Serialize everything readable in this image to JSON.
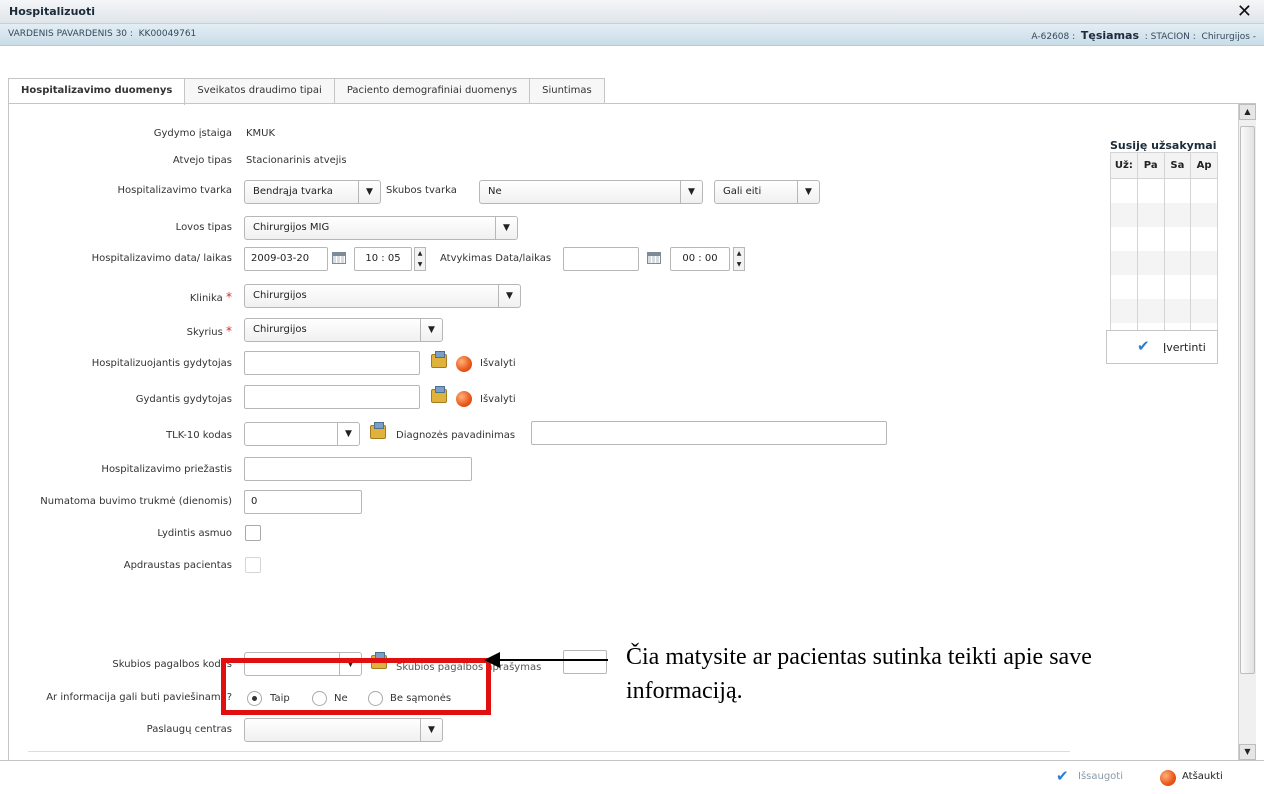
{
  "window": {
    "title": "Hospitalizuoti",
    "close_glyph": "✕"
  },
  "infobar": {
    "patient": "VARDENIS PAVARDENIS 30 :",
    "patient_code": "KK00049761",
    "case_code": "A-62608 :",
    "status": "Tęsiamas",
    "dept_type": ":  STACION :",
    "dept": "Chirurgijos -"
  },
  "tabs": [
    {
      "label": "Hospitalizavimo duomenys",
      "active": true
    },
    {
      "label": "Sveikatos draudimo tipai",
      "active": false
    },
    {
      "label": "Paciento demografiniai duomenys",
      "active": false
    },
    {
      "label": "Siuntimas",
      "active": false
    }
  ],
  "form": {
    "gydymo_istaiga": {
      "label": "Gydymo įstaiga",
      "value": "KMUK"
    },
    "atvejo_tipas": {
      "label": "Atvejo tipas",
      "value": "Stacionarinis atvejis"
    },
    "hosp_tvarka": {
      "label": "Hospitalizavimo tvarka",
      "value": "Bendrąja tvarka"
    },
    "skubos_tvarka": {
      "label": "Skubos tvarka",
      "value": "Ne"
    },
    "gali_eiti": {
      "value": "Gali eiti"
    },
    "lovos_tipas": {
      "label": "Lovos tipas",
      "value": "Chirurgijos  MIG"
    },
    "hosp_data": {
      "label": "Hospitalizavimo data/ laikas",
      "date": "2009-03-20",
      "time": "10 : 05"
    },
    "atvykimas": {
      "label": "Atvykimas Data/laikas",
      "date": "",
      "time": "00 : 00"
    },
    "klinika": {
      "label": "Klinika",
      "value": "Chirurgijos"
    },
    "skyrius": {
      "label": "Skyrius",
      "value": "Chirurgijos"
    },
    "hosp_gydytojas": {
      "label": "Hospitalizuojantis gydytojas",
      "value": "",
      "clear": "Išvalyti"
    },
    "gydantis_gydytojas": {
      "label": "Gydantis gydytojas",
      "value": "",
      "clear": "Išvalyti"
    },
    "tlk": {
      "label": "TLK-10 kodas",
      "value": "",
      "diag_label": "Diagnozės pavadinimas",
      "diag_value": ""
    },
    "priezastis": {
      "label": "Hospitalizavimo priežastis",
      "value": ""
    },
    "trukme": {
      "label": "Numatoma buvimo trukmė (dienomis)",
      "value": "0"
    },
    "lydintis": {
      "label": "Lydintis asmuo",
      "checked": false
    },
    "apdraustas": {
      "label": "Apdraustas pacientas",
      "checked": false
    },
    "skubios_kodas": {
      "label": "Skubios pagalbos kodas",
      "value": "",
      "desc_label": "Skubios pagalbos aprašymas"
    },
    "informacija": {
      "label": "Ar informacija gali buti paviešinama?",
      "options": [
        {
          "label": "Taip",
          "selected": true
        },
        {
          "label": "Ne",
          "selected": false
        },
        {
          "label": "Be sąmonės",
          "selected": false
        }
      ]
    },
    "paslaugu_centras": {
      "label": "Paslaugų centras",
      "value": ""
    }
  },
  "related_orders": {
    "title": "Susiję užsakymai",
    "columns": [
      "Už:",
      "Pa",
      "Sa",
      "Ap"
    ],
    "rows": 7,
    "button": "Įvertinti"
  },
  "footer": {
    "save": "Išsaugoti",
    "cancel": "Atšaukti"
  },
  "annotation": {
    "text": "Čia matysite ar pacientas sutinka teikti apie save informaciją."
  },
  "colors": {
    "highlight": "#e01010",
    "accent": "#2a7fd0"
  }
}
